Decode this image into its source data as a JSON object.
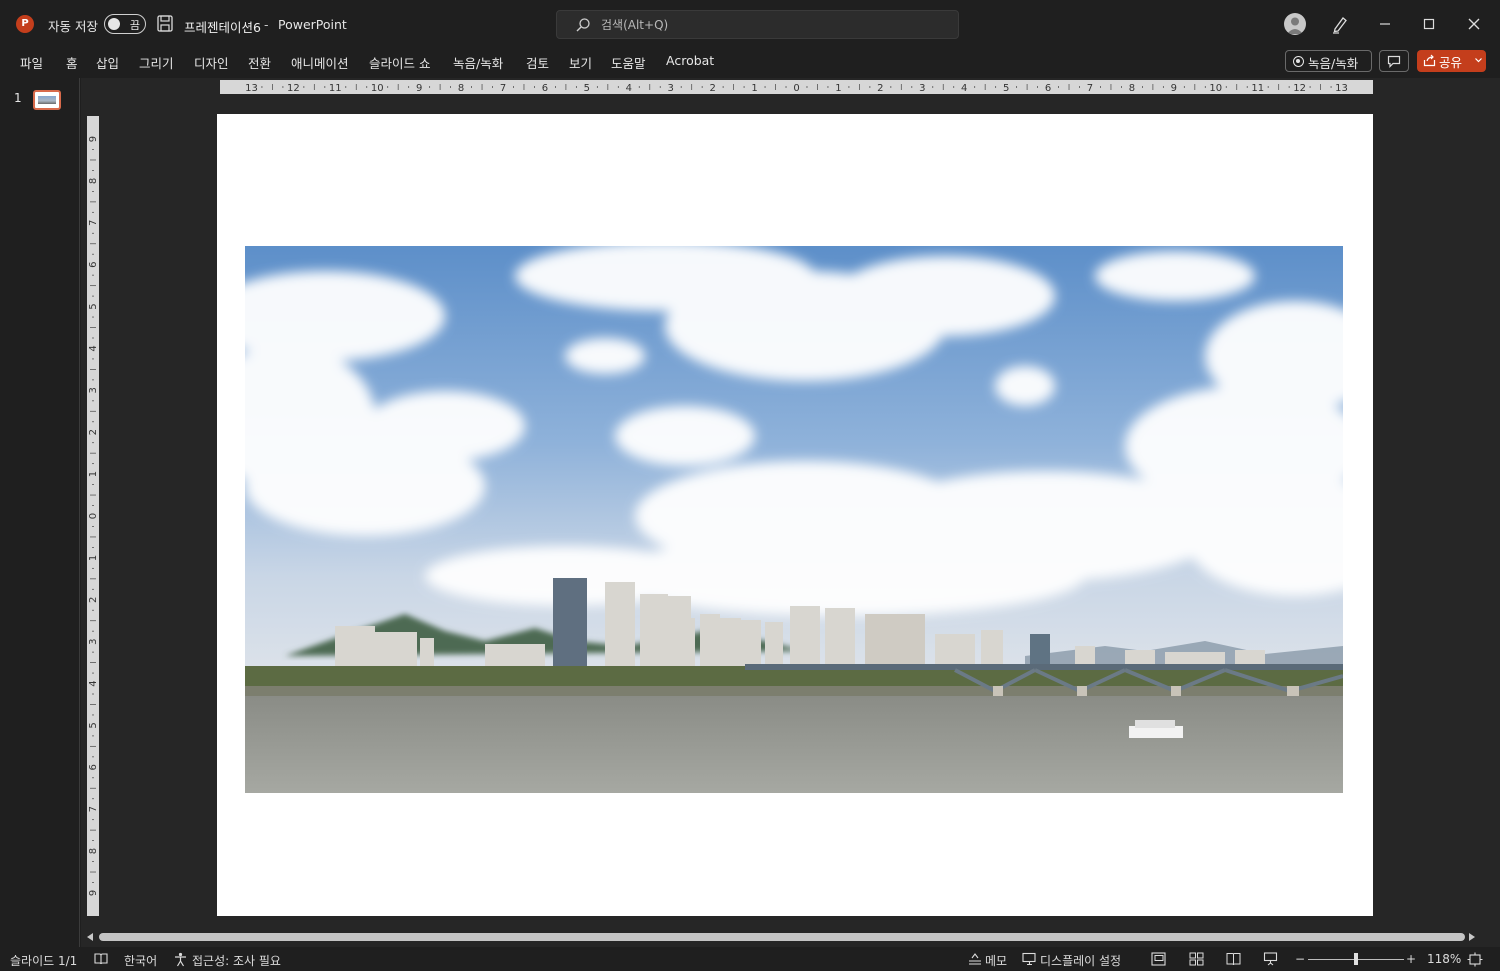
{
  "titlebar": {
    "app_logo_letter": "P",
    "autosave_label": "자동 저장",
    "autosave_state": "끔",
    "document_name": "프레젠테이션6",
    "separator": "-",
    "app_name": "PowerPoint",
    "search_placeholder": "검색(Alt+Q)"
  },
  "ribbon": {
    "tabs": [
      "파일",
      "홈",
      "삽입",
      "그리기",
      "디자인",
      "전환",
      "애니메이션",
      "슬라이드 쇼",
      "녹음/녹화",
      "검토",
      "보기",
      "도움말",
      "Acrobat"
    ],
    "record_label": "녹음/녹화",
    "share_label": "공유"
  },
  "thumbnails": {
    "items": [
      {
        "number": "1"
      }
    ]
  },
  "rulers": {
    "horizontal_labels": [
      "13",
      "12",
      "11",
      "10",
      "9",
      "8",
      "7",
      "6",
      "5",
      "4",
      "3",
      "2",
      "1",
      "0",
      "1",
      "2",
      "3",
      "4",
      "5",
      "6",
      "7",
      "8",
      "9",
      "10",
      "11",
      "12",
      "13"
    ],
    "vertical_labels": [
      "9",
      "8",
      "7",
      "6",
      "5",
      "4",
      "3",
      "2",
      "1",
      "0",
      "1",
      "2",
      "3",
      "4",
      "5",
      "6",
      "7",
      "8",
      "9"
    ]
  },
  "statusbar": {
    "slide_info": "슬라이드 1/1",
    "language": "한국어",
    "accessibility": "접근성: 조사 필요",
    "notes_label": "메모",
    "display_settings_label": "디스플레이 설정",
    "zoom_minus": "−",
    "zoom_plus": "+",
    "zoom_level": "118%",
    "zoom_fraction": 0.5
  },
  "colors": {
    "accent": "#c43e1c",
    "thumb_border": "#d86a4b",
    "background": "#1f1f1f",
    "canvas": "#262626"
  },
  "icons": [
    "powerpoint-logo-icon",
    "save-icon",
    "search-icon",
    "pen-icon",
    "minimize-icon",
    "maximize-icon",
    "close-icon",
    "comment-icon",
    "share-icon",
    "chevron-down-icon",
    "book-icon",
    "accessibility-icon",
    "notes-icon",
    "display-settings-icon",
    "normal-view-icon",
    "slide-sorter-icon",
    "reading-view-icon",
    "slideshow-icon",
    "fit-slide-icon"
  ]
}
